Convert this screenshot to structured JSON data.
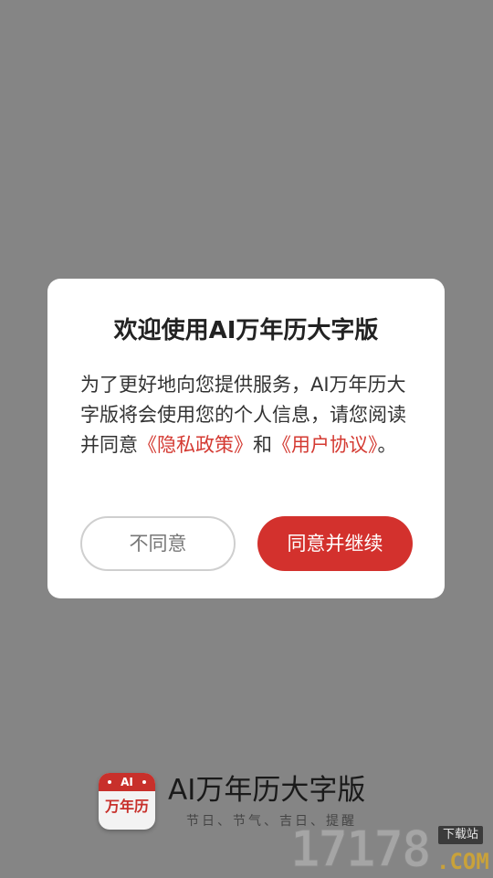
{
  "dialog": {
    "title": "欢迎使用AI万年历大字版",
    "body_part1": "为了更好地向您提供服务，AI万年历大字版将会使用您的个人信息，请您阅读并同意",
    "privacy_link": "《隐私政策》",
    "body_part2": "和",
    "terms_link": "《用户协议》",
    "body_part3": "。",
    "disagree_label": "不同意",
    "agree_label": "同意并继续"
  },
  "brand": {
    "logo_badge": "AI",
    "logo_text": "万年历",
    "name": "AI万年历大字版",
    "tagline": "节日、节气、吉日、提醒"
  },
  "watermark": {
    "number": "17178",
    "tag": "下载站",
    "suffix": ".COM"
  },
  "colors": {
    "overlay": "#858585",
    "accent_red": "#d3312d",
    "link_red": "#d43a32"
  }
}
